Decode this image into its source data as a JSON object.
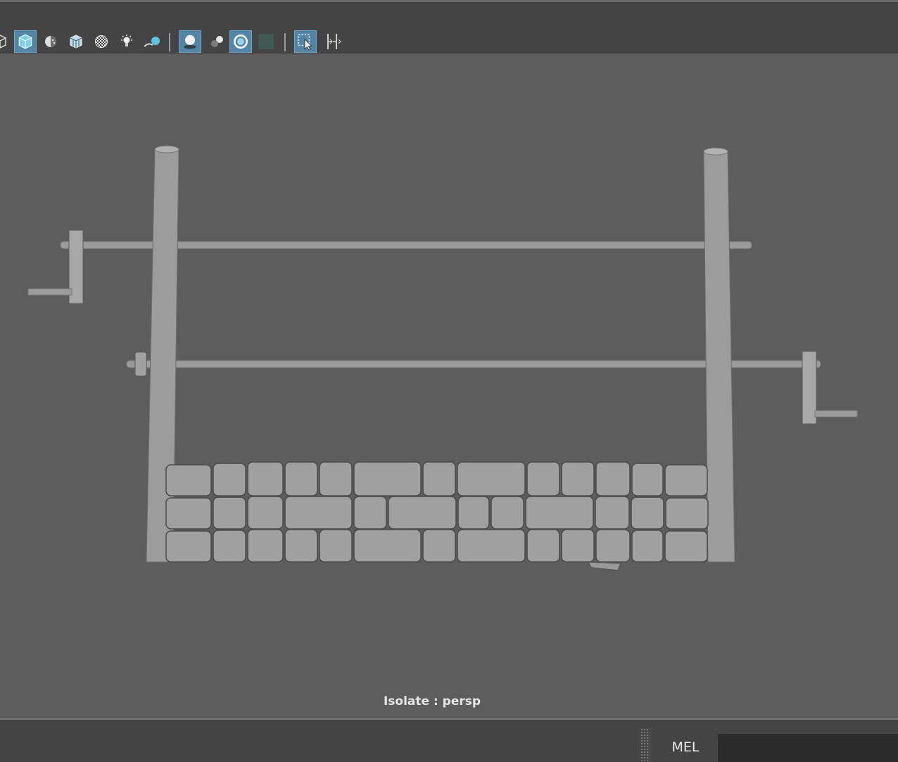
{
  "toolbar": {
    "icons": [
      {
        "name": "wireframe-cube-icon",
        "active": false
      },
      {
        "name": "smooth-shade-cube-icon",
        "active": true
      },
      {
        "name": "flat-shade-sphere-icon",
        "active": false
      },
      {
        "name": "wireframe-on-shaded-icon",
        "active": false
      },
      {
        "name": "xray-checker-icon",
        "active": false
      },
      {
        "name": "lights-bulb-icon",
        "active": false
      },
      {
        "name": "shadows-icon",
        "active": false
      },
      {
        "name": "ambient-occlusion-icon",
        "active": true
      },
      {
        "name": "motion-blur-icon",
        "active": false
      },
      {
        "name": "anti-aliasing-icon",
        "active": true
      },
      {
        "name": "depth-of-field-icon",
        "active": false
      },
      {
        "name": "isolate-select-icon",
        "active": true
      },
      {
        "name": "gate-mask-icon",
        "active": false
      }
    ]
  },
  "viewport": {
    "hud_label": "Isolate : persp"
  },
  "command_line": {
    "language_label": "MEL",
    "input_value": ""
  },
  "colors": {
    "viewport_bg": "#5d5d5d",
    "ui_bg": "#444444",
    "active_accent": "#5285a6",
    "model_gray": "#9b9b9b"
  }
}
